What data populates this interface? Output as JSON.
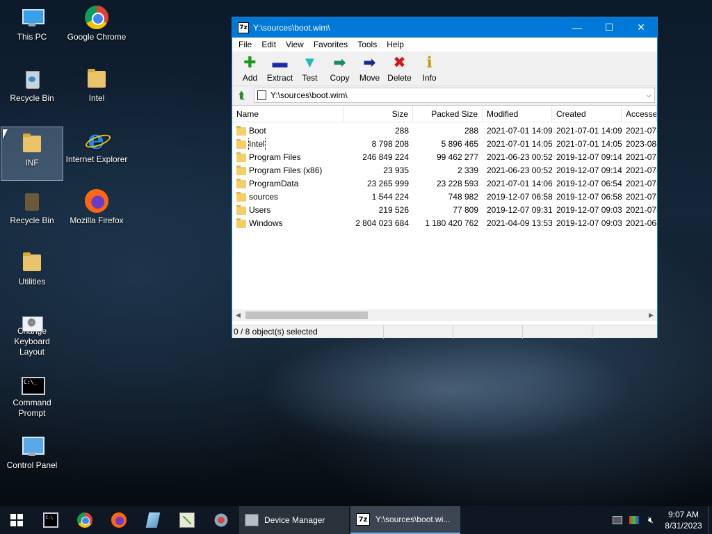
{
  "desktop": {
    "icons": [
      {
        "label": "This PC"
      },
      {
        "label": "Google Chrome"
      },
      {
        "label": "Recycle Bin"
      },
      {
        "label": "Intel"
      },
      {
        "label": "INF"
      },
      {
        "label": "Internet Explorer"
      },
      {
        "label": "Recycle Bin"
      },
      {
        "label": "Mozilla Firefox"
      },
      {
        "label": "Utilities"
      },
      {
        "label": "Change Keyboard Layout"
      },
      {
        "label": "Command Prompt"
      },
      {
        "label": "Control Panel"
      }
    ]
  },
  "window": {
    "app_icon": "7z",
    "title": "Y:\\sources\\boot.wim\\",
    "controls": {
      "minimize": "—",
      "maximize": "☐",
      "close": "✕"
    },
    "menu": [
      "File",
      "Edit",
      "View",
      "Favorites",
      "Tools",
      "Help"
    ],
    "toolbar": [
      {
        "label": "Add",
        "icon": "add-icon",
        "glyph": "✚",
        "color": "#1a9a1a"
      },
      {
        "label": "Extract",
        "icon": "extract-icon",
        "glyph": "▬",
        "color": "#1a2aa8"
      },
      {
        "label": "Test",
        "icon": "test-icon",
        "glyph": "▼",
        "color": "#2ab8b8"
      },
      {
        "label": "Copy",
        "icon": "copy-icon",
        "glyph": "➡",
        "color": "#1a8a6a"
      },
      {
        "label": "Move",
        "icon": "move-icon",
        "glyph": "➡",
        "color": "#1a2a8a"
      },
      {
        "label": "Delete",
        "icon": "delete-icon",
        "glyph": "✖",
        "color": "#d01818"
      },
      {
        "label": "Info",
        "icon": "info-icon",
        "glyph": "ℹ",
        "color": "#c0a000"
      }
    ],
    "address": "Y:\\sources\\boot.wim\\",
    "columns": {
      "name": "Name",
      "size": "Size",
      "packed": "Packed Size",
      "modified": "Modified",
      "created": "Created",
      "accessed": "Accesse"
    },
    "rows": [
      {
        "name": "Boot",
        "size": "288",
        "packed": "288",
        "modified": "2021-07-01 14:09",
        "created": "2021-07-01 14:09",
        "accessed": "2021-07-"
      },
      {
        "name": "Intel",
        "size": "8 798 208",
        "packed": "5 896 465",
        "modified": "2021-07-01 14:05",
        "created": "2021-07-01 14:05",
        "accessed": "2023-08-"
      },
      {
        "name": "Program Files",
        "size": "246 849 224",
        "packed": "99 462 277",
        "modified": "2021-06-23 00:52",
        "created": "2019-12-07 09:14",
        "accessed": "2021-07-"
      },
      {
        "name": "Program Files (x86)",
        "size": "23 935",
        "packed": "2 339",
        "modified": "2021-06-23 00:52",
        "created": "2019-12-07 09:14",
        "accessed": "2021-07-"
      },
      {
        "name": "ProgramData",
        "size": "23 265 999",
        "packed": "23 228 593",
        "modified": "2021-07-01 14:06",
        "created": "2019-12-07 06:54",
        "accessed": "2021-07-"
      },
      {
        "name": "sources",
        "size": "1 544 224",
        "packed": "748 982",
        "modified": "2019-12-07 06:58",
        "created": "2019-12-07 06:58",
        "accessed": "2021-07-"
      },
      {
        "name": "Users",
        "size": "219 526",
        "packed": "77 809",
        "modified": "2019-12-07 09:31",
        "created": "2019-12-07 09:03",
        "accessed": "2021-07-"
      },
      {
        "name": "Windows",
        "size": "2 804 023 684",
        "packed": "1 180 420 762",
        "modified": "2021-04-09 13:53",
        "created": "2019-12-07 09:03",
        "accessed": "2021-06-"
      }
    ],
    "status": "0 / 8 object(s) selected"
  },
  "taskbar": {
    "tasks": [
      {
        "label": "Device Manager"
      },
      {
        "label": "Y:\\sources\\boot.wi..."
      }
    ],
    "clock": {
      "time": "9:07 AM",
      "date": "8/31/2023"
    },
    "colors": {
      "accent": "#0078d7"
    }
  }
}
